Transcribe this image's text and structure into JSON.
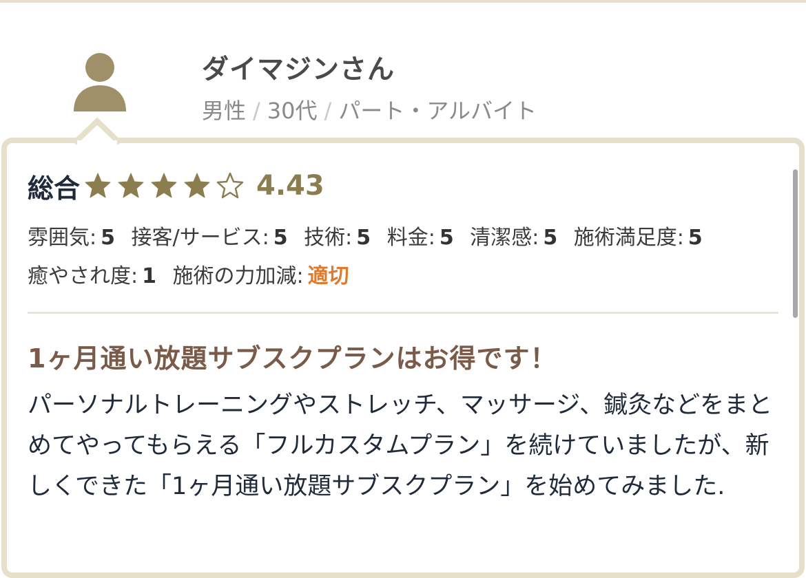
{
  "reviewer": {
    "name": "ダイマジンさん",
    "gender": "男性",
    "age": "30代",
    "occupation": "パート・アルバイト",
    "separator": "/"
  },
  "rating": {
    "label": "総合",
    "score": "4.43",
    "stars_filled": 4,
    "stars_total": 5
  },
  "subscores": [
    {
      "label": "雰囲気:",
      "value": "5"
    },
    {
      "label": "接客/サービス:",
      "value": "5"
    },
    {
      "label": "技術:",
      "value": "5"
    },
    {
      "label": "料金:",
      "value": "5"
    },
    {
      "label": "清潔感:",
      "value": "5"
    },
    {
      "label": "施術満足度:",
      "value": "5"
    },
    {
      "label": "癒やされ度:",
      "value": "1"
    },
    {
      "label": "施術の力加減:",
      "value": "適切"
    }
  ],
  "review": {
    "title": "1ヶ月通い放題サブスクプランはお得です！",
    "body": "パーソナルトレーニングやストレッチ、マッサージ、鍼灸などをまとめてやってもらえる「フルカスタムプラン」を続けていましたが、新しくできた「1ヶ月通い放題サブスクプラン」を始めてみました."
  },
  "colors": {
    "accent": "#e07a2c",
    "gold": "#8b7d50",
    "border": "#e6dfca",
    "title": "#7a5a48"
  }
}
